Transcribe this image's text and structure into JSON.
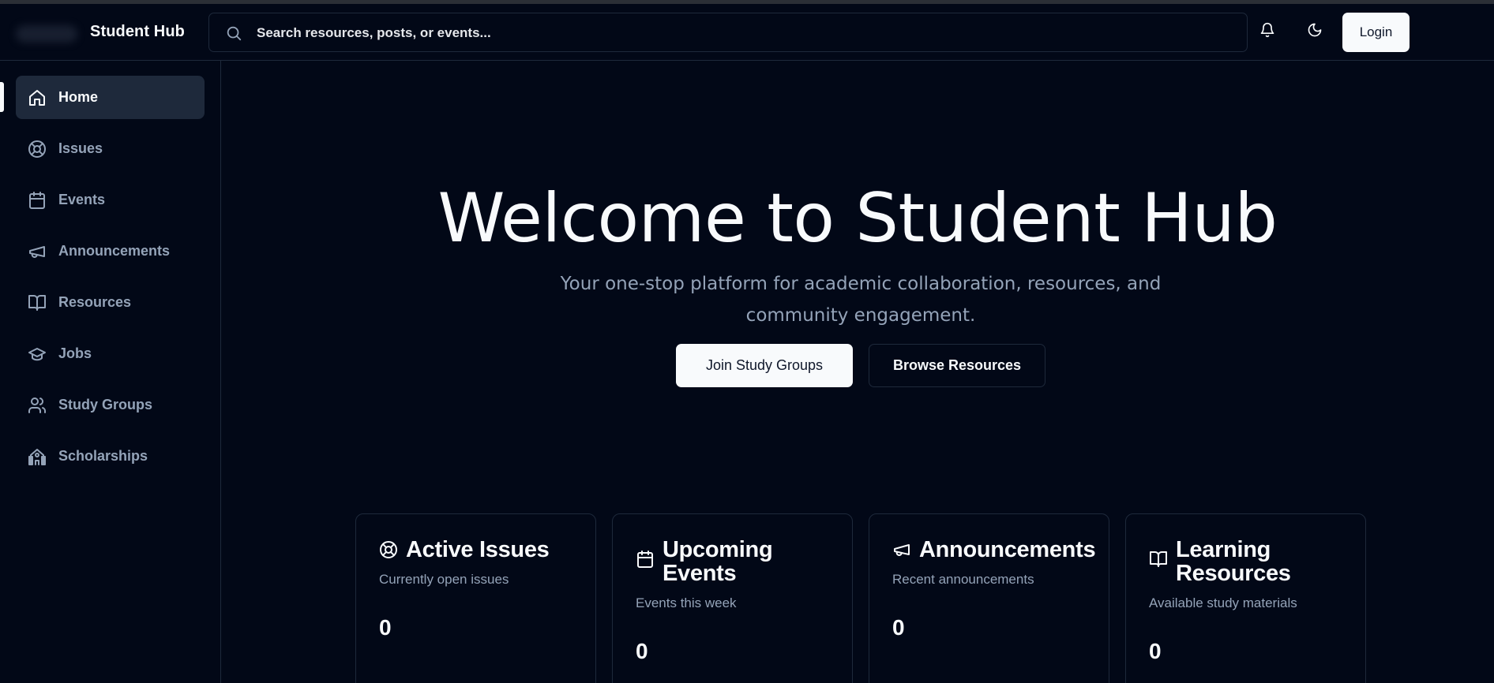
{
  "header": {
    "brand": "Student Hub",
    "search_placeholder": "Search resources, posts, or events...",
    "login_label": "Login"
  },
  "sidebar": {
    "items": [
      {
        "label": "Home",
        "icon": "home-icon",
        "active": true
      },
      {
        "label": "Issues",
        "icon": "lifebuoy-icon",
        "active": false
      },
      {
        "label": "Events",
        "icon": "calendar-icon",
        "active": false
      },
      {
        "label": "Announcements",
        "icon": "megaphone-icon",
        "active": false
      },
      {
        "label": "Resources",
        "icon": "book-open-icon",
        "active": false
      },
      {
        "label": "Jobs",
        "icon": "graduation-cap-icon",
        "active": false
      },
      {
        "label": "Study Groups",
        "icon": "users-icon",
        "active": false
      },
      {
        "label": "Scholarships",
        "icon": "school-icon",
        "active": false
      }
    ]
  },
  "hero": {
    "title": "Welcome to Student Hub",
    "subtitle": "Your one-stop platform for academic collaboration, resources, and community engagement.",
    "primary_button": "Join Study Groups",
    "secondary_button": "Browse Resources"
  },
  "cards": [
    {
      "title": "Active Issues",
      "description": "Currently open issues",
      "value": "0",
      "icon": "lifebuoy-icon"
    },
    {
      "title": "Upcoming Events",
      "description": "Events this week",
      "value": "0",
      "icon": "calendar-icon"
    },
    {
      "title": "Announcements",
      "description": "Recent announcements",
      "value": "0",
      "icon": "megaphone-icon"
    },
    {
      "title": "Learning Resources",
      "description": "Available study materials",
      "value": "0",
      "icon": "book-open-icon"
    }
  ],
  "colors": {
    "background": "#020817",
    "border": "#1e293b",
    "muted_text": "#94a3b8",
    "foreground": "#f8fafc"
  }
}
